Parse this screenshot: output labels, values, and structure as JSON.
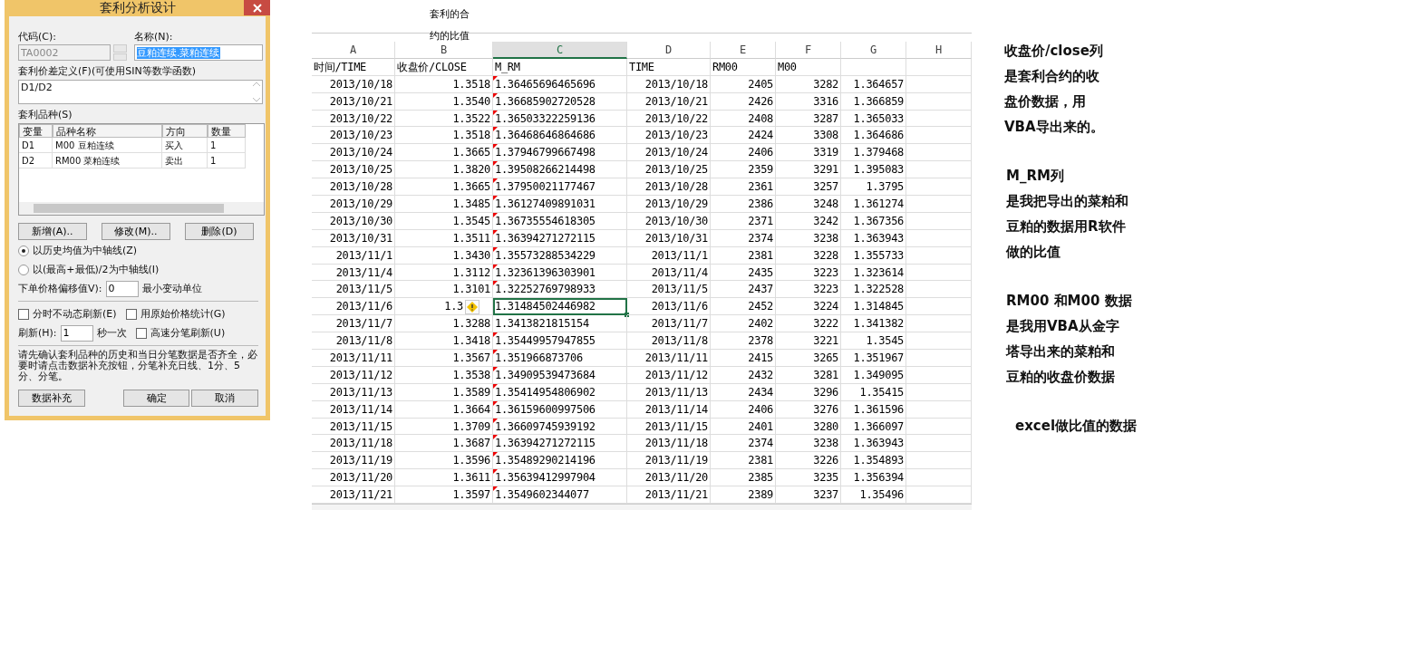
{
  "dialog": {
    "title": "套利分析设计",
    "code_label": "代码(C):",
    "code_value": "TA0002",
    "name_label": "名称(N):",
    "name_value": "豆粕连续.菜粕连续",
    "formula_label": "套利价差定义(F)(可使用SIN等数学函数)",
    "formula_value": "D1/D2",
    "varieties_label": "套利品种(S)",
    "variety_columns": [
      "变量",
      "品种名称",
      "方向",
      "数量"
    ],
    "variety_rows": [
      [
        "D1",
        "M00 豆粕连续",
        "买入",
        "1"
      ],
      [
        "D2",
        "RM00 菜粕连续",
        "卖出",
        "1"
      ]
    ],
    "buttons": [
      "新增(A)..",
      "修改(M)..",
      "删除(D)"
    ],
    "axis_options": [
      {
        "label": "以历史均值为中轴线(Z)",
        "selected": true
      },
      {
        "label": "以(最高+最低)/2为中轴线(I)",
        "selected": false
      }
    ],
    "offset_label": "下单价格偏移值V):",
    "offset_value": "0",
    "offset_unit": "最小变动单位",
    "checkboxes": [
      {
        "label": "分时不动态刷新(E)",
        "checked": false
      },
      {
        "label": "用原始价格统计(G)",
        "checked": false
      },
      {
        "label": "高速分笔刷新(U)",
        "checked": false
      }
    ],
    "refresh_label": "刷新(H):",
    "refresh_value": "1",
    "refresh_unit": "秒一次",
    "notice": "请先确认套利品种的历史和当日分笔数据是否齐全，必要时请点击数据补充按钮，分笔补充日线、1分、5分、分笔。",
    "bottom_buttons": [
      "数据补充",
      "确定",
      "取消"
    ]
  },
  "sheet": {
    "textbox": [
      "套利的合",
      "约的比值"
    ],
    "columns": [
      {
        "label": "A",
        "selected": false
      },
      {
        "label": "B",
        "selected": false
      },
      {
        "label": "C",
        "selected": true
      },
      {
        "label": "D",
        "selected": false
      },
      {
        "label": "E",
        "selected": false
      },
      {
        "label": "F",
        "selected": false
      },
      {
        "label": "G",
        "selected": false
      },
      {
        "label": "H",
        "selected": false
      }
    ],
    "header": [
      "时间/TIME",
      "收盘价/CLOSE",
      "M_RM",
      "TIME",
      "RM00",
      "M00"
    ],
    "rows": [
      {
        "cells": [
          "2013/10/18",
          "1.3518",
          "1.36465696465696",
          "2013/10/18",
          "2405",
          "3282",
          "1.364657"
        ],
        "flag": true,
        "selected": false,
        "warning": false
      },
      {
        "cells": [
          "2013/10/21",
          "1.3540",
          "1.36685902720528",
          "2013/10/21",
          "2426",
          "3316",
          "1.366859"
        ],
        "flag": true,
        "selected": false,
        "warning": false
      },
      {
        "cells": [
          "2013/10/22",
          "1.3522",
          "1.36503322259136",
          "2013/10/22",
          "2408",
          "3287",
          "1.365033"
        ],
        "flag": true,
        "selected": false,
        "warning": false
      },
      {
        "cells": [
          "2013/10/23",
          "1.3518",
          "1.36468646864686",
          "2013/10/23",
          "2424",
          "3308",
          "1.364686"
        ],
        "flag": true,
        "selected": false,
        "warning": false
      },
      {
        "cells": [
          "2013/10/24",
          "1.3665",
          "1.37946799667498",
          "2013/10/24",
          "2406",
          "3319",
          "1.379468"
        ],
        "flag": true,
        "selected": false,
        "warning": false
      },
      {
        "cells": [
          "2013/10/25",
          "1.3820",
          "1.39508266214498",
          "2013/10/25",
          "2359",
          "3291",
          "1.395083"
        ],
        "flag": true,
        "selected": false,
        "warning": false
      },
      {
        "cells": [
          "2013/10/28",
          "1.3665",
          "1.37950021177467",
          "2013/10/28",
          "2361",
          "3257",
          "1.3795"
        ],
        "flag": true,
        "selected": false,
        "warning": false
      },
      {
        "cells": [
          "2013/10/29",
          "1.3485",
          "1.36127409891031",
          "2013/10/29",
          "2386",
          "3248",
          "1.361274"
        ],
        "flag": true,
        "selected": false,
        "warning": false
      },
      {
        "cells": [
          "2013/10/30",
          "1.3545",
          "1.36735554618305",
          "2013/10/30",
          "2371",
          "3242",
          "1.367356"
        ],
        "flag": true,
        "selected": false,
        "warning": false
      },
      {
        "cells": [
          "2013/10/31",
          "1.3511",
          "1.36394271272115",
          "2013/10/31",
          "2374",
          "3238",
          "1.363943"
        ],
        "flag": true,
        "selected": false,
        "warning": false
      },
      {
        "cells": [
          "2013/11/1",
          "1.3430",
          "1.35573288534229",
          "2013/11/1",
          "2381",
          "3228",
          "1.355733"
        ],
        "flag": true,
        "selected": false,
        "warning": false
      },
      {
        "cells": [
          "2013/11/4",
          "1.3112",
          "1.32361396303901",
          "2013/11/4",
          "2435",
          "3223",
          "1.323614"
        ],
        "flag": true,
        "selected": false,
        "warning": false
      },
      {
        "cells": [
          "2013/11/5",
          "1.3101",
          "1.32252769798933",
          "2013/11/5",
          "2437",
          "3223",
          "1.322528"
        ],
        "flag": true,
        "selected": false,
        "warning": false
      },
      {
        "cells": [
          "2013/11/6",
          "1.3",
          "1.31484502446982",
          "2013/11/6",
          "2452",
          "3224",
          "1.314845"
        ],
        "flag": false,
        "selected": true,
        "warning": true
      },
      {
        "cells": [
          "2013/11/7",
          "1.3288",
          "1.3413821815154",
          "2013/11/7",
          "2402",
          "3222",
          "1.341382"
        ],
        "flag": false,
        "selected": false,
        "warning": false
      },
      {
        "cells": [
          "2013/11/8",
          "1.3418",
          "1.35449957947855",
          "2013/11/8",
          "2378",
          "3221",
          "1.3545"
        ],
        "flag": true,
        "selected": false,
        "warning": false
      },
      {
        "cells": [
          "2013/11/11",
          "1.3567",
          "1.351966873706",
          "2013/11/11",
          "2415",
          "3265",
          "1.351967"
        ],
        "flag": true,
        "selected": false,
        "warning": false
      },
      {
        "cells": [
          "2013/11/12",
          "1.3538",
          "1.34909539473684",
          "2013/11/12",
          "2432",
          "3281",
          "1.349095"
        ],
        "flag": true,
        "selected": false,
        "warning": false
      },
      {
        "cells": [
          "2013/11/13",
          "1.3589",
          "1.35414954806902",
          "2013/11/13",
          "2434",
          "3296",
          "1.35415"
        ],
        "flag": true,
        "selected": false,
        "warning": false
      },
      {
        "cells": [
          "2013/11/14",
          "1.3664",
          "1.36159600997506",
          "2013/11/14",
          "2406",
          "3276",
          "1.361596"
        ],
        "flag": true,
        "selected": false,
        "warning": false
      },
      {
        "cells": [
          "2013/11/15",
          "1.3709",
          "1.36609745939192",
          "2013/11/15",
          "2401",
          "3280",
          "1.366097"
        ],
        "flag": true,
        "selected": false,
        "warning": false
      },
      {
        "cells": [
          "2013/11/18",
          "1.3687",
          "1.36394271272115",
          "2013/11/18",
          "2374",
          "3238",
          "1.363943"
        ],
        "flag": true,
        "selected": false,
        "warning": false
      },
      {
        "cells": [
          "2013/11/19",
          "1.3596",
          "1.35489290214196",
          "2013/11/19",
          "2381",
          "3226",
          "1.354893"
        ],
        "flag": true,
        "selected": false,
        "warning": false
      },
      {
        "cells": [
          "2013/11/20",
          "1.3611",
          "1.35639412997904",
          "2013/11/20",
          "2385",
          "3235",
          "1.356394"
        ],
        "flag": true,
        "selected": false,
        "warning": false
      },
      {
        "cells": [
          "2013/11/21",
          "1.3597",
          "1.3549602344077",
          "2013/11/21",
          "2389",
          "3237",
          "1.35496"
        ],
        "flag": true,
        "selected": false,
        "warning": false
      }
    ]
  },
  "notes": [
    [
      "收盘价/close列",
      "是套利合约的收",
      "盘价数据，用",
      "VBA导出来的。"
    ],
    [
      "M_RM列",
      "是我把导出的菜粕和",
      "豆粕的数据用R软件",
      "做的比值"
    ],
    [
      "RM00 和M00 数据",
      "是我用VBA从金字",
      "塔导出来的菜粕和",
      "豆粕的收盘价数据"
    ],
    [
      "excel做比值的数据"
    ]
  ]
}
